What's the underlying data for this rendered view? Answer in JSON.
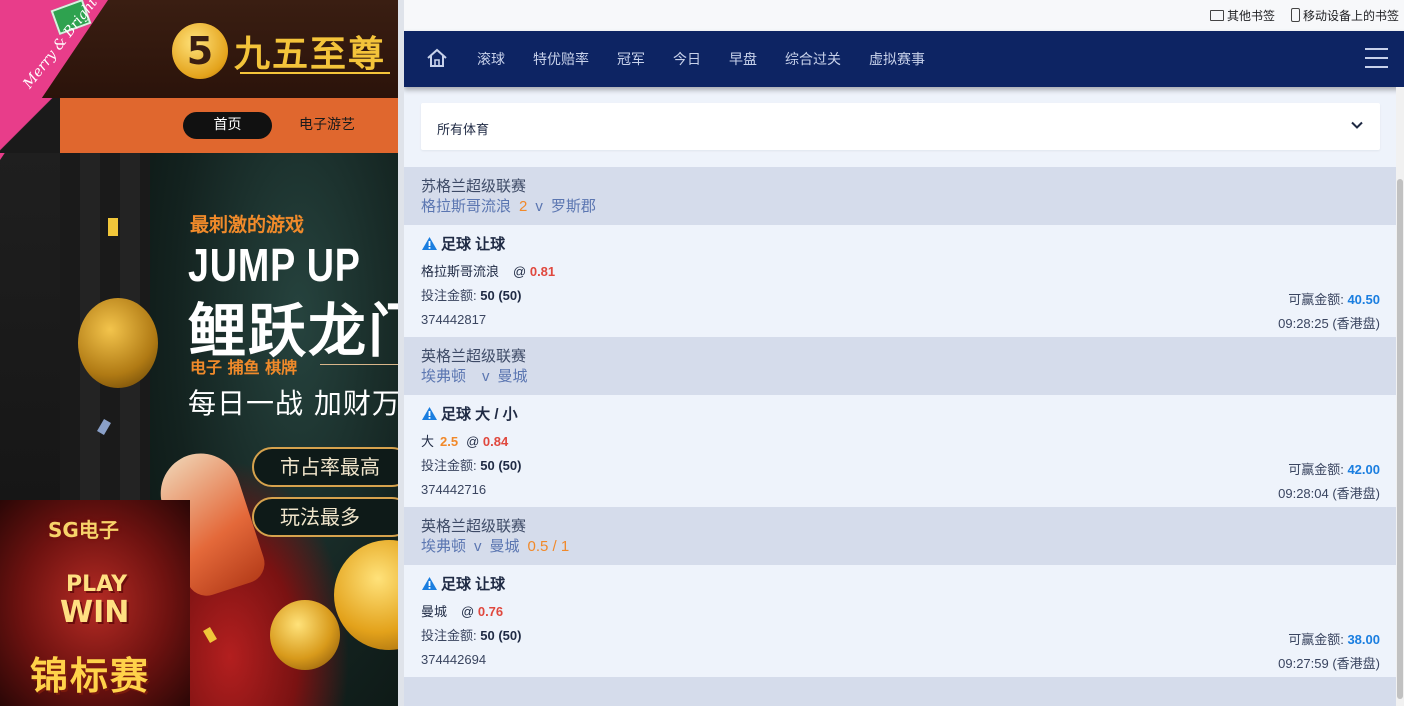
{
  "left_site": {
    "logo_mark": "5",
    "logo_text": "九五至尊",
    "xmas_text": "Merry & Bright",
    "nav": {
      "home": "首页",
      "games": "电子游艺"
    },
    "promo": {
      "subtitle": "最刺激的游戏",
      "title_en": "JUMP UP",
      "title_cn": "鲤跃龙门",
      "tags": "电子  捕鱼  棋牌",
      "daily": "每日一战  加财万",
      "pill1": "市占率最高",
      "pill2": "玩法最多"
    },
    "sg": {
      "brand": "SG电子",
      "play": "PLAY",
      "win": "WIN",
      "tournament": "锦标赛"
    }
  },
  "bookmarks": {
    "other": "其他书签",
    "mobile": "移动设备上的书签"
  },
  "sportsbook": {
    "nav": [
      "滚球",
      "特优赔率",
      "冠军",
      "今日",
      "早盘",
      "综合过关",
      "虚拟赛事"
    ],
    "sport_filter": "所有体育",
    "labels": {
      "stake": "投注金额:",
      "payout": "可赢金额:",
      "at": "@"
    },
    "bets": [
      {
        "league": "苏格兰超级联赛",
        "home": "格拉斯哥流浪",
        "head_handicap": "2",
        "vs": "v",
        "away": "罗斯郡",
        "market": "足球 让球",
        "selection": "格拉斯哥流浪",
        "sel_handicap": "",
        "odds": "0.81",
        "stake": "50 (50)",
        "payout": "40.50",
        "ref": "374442817",
        "time": "09:28:25 (香港盘)"
      },
      {
        "league": "英格兰超级联赛",
        "home": "埃弗顿",
        "head_handicap": "",
        "vs": "v",
        "away": "曼城",
        "market": "足球 大 / 小",
        "selection": "大",
        "sel_handicap": "2.5",
        "odds": "0.84",
        "stake": "50 (50)",
        "payout": "42.00",
        "ref": "374442716",
        "time": "09:28:04 (香港盘)"
      },
      {
        "league": "英格兰超级联赛",
        "home": "埃弗顿",
        "head_handicap": "0.5 / 1",
        "vs": "v",
        "away": "曼城",
        "market": "足球 让球",
        "selection": "曼城",
        "sel_handicap": "",
        "odds": "0.76",
        "stake": "50 (50)",
        "payout": "38.00",
        "ref": "374442694",
        "time": "09:27:59 (香港盘)"
      }
    ]
  },
  "colors": {
    "nav_bg": "#0d2463",
    "league_bg": "#d5dceb",
    "odds": "#e0483e",
    "handicap": "#f1892a",
    "payout": "#1a7ee0",
    "casino_orange": "#e0672e"
  },
  "icons": [
    "home-icon",
    "menu-icon",
    "chevron-down-icon",
    "warning-icon",
    "folder-icon",
    "phone-icon"
  ]
}
